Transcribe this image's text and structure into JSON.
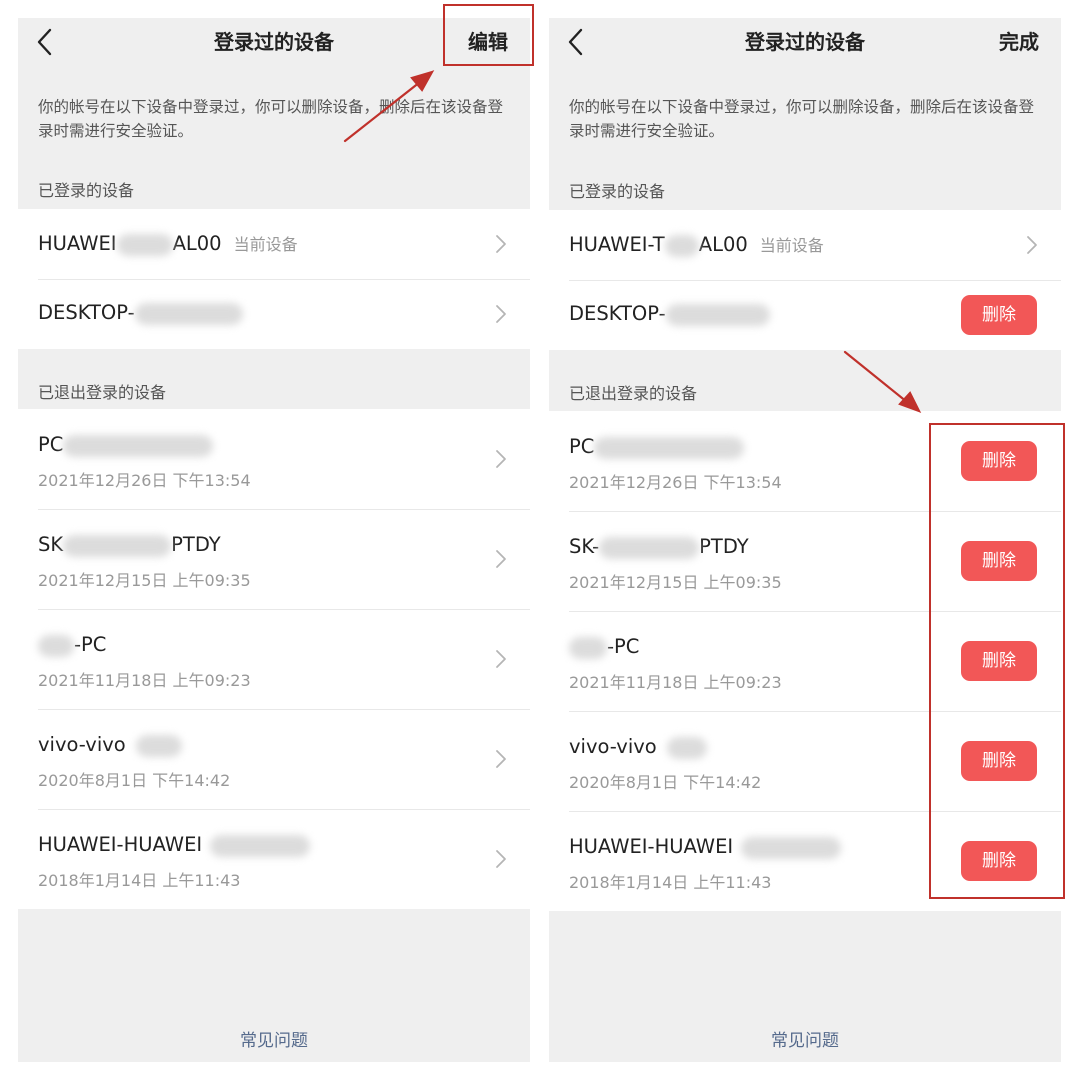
{
  "screens": {
    "left": {
      "back_icon": "chevron-left-icon",
      "title": "登录过的设备",
      "action": "编辑",
      "description": "你的帐号在以下设备中登录过，你可以删除设备，删除后在该设备登录时需进行安全验证。",
      "section_logged_in": "已登录的设备",
      "section_logged_out": "已退出登录的设备",
      "faq": "常见问题"
    },
    "right": {
      "back_icon": "chevron-left-icon",
      "title": "登录过的设备",
      "action": "完成",
      "description": "你的帐号在以下设备中登录过，你可以删除设备，删除后在该设备登录时需进行安全验证。",
      "section_logged_in": "已登录的设备",
      "section_logged_out": "已退出登录的设备",
      "delete_label": "删除",
      "faq": "常见问题"
    }
  },
  "devices_logged_in": {
    "left": [
      {
        "prefix": "HUAWEI",
        "suffix": "AL00",
        "tag": "当前设备"
      },
      {
        "prefix": "DESKTOP-",
        "suffix": ""
      }
    ],
    "right": [
      {
        "prefix": "HUAWEI-T",
        "suffix": "AL00",
        "tag": "当前设备"
      },
      {
        "prefix": "DESKTOP-",
        "suffix": ""
      }
    ]
  },
  "devices_logged_out": {
    "left": [
      {
        "prefix": "PC",
        "suffix": "",
        "time": "2021年12月26日 下午13:54"
      },
      {
        "prefix": "SK",
        "suffix": "PTDY",
        "time": "2021年12月15日 上午09:35"
      },
      {
        "prefix": "",
        "suffix": "-PC",
        "time": "2021年11月18日 上午09:23"
      },
      {
        "prefix": "vivo-vivo",
        "suffix": "",
        "time": "2020年8月1日 下午14:42"
      },
      {
        "prefix": "HUAWEI-HUAWEI",
        "suffix": "",
        "time": "2018年1月14日 上午11:43"
      }
    ],
    "right": [
      {
        "prefix": "PC",
        "suffix": "",
        "time": "2021年12月26日 下午13:54"
      },
      {
        "prefix": "SK-",
        "suffix": "PTDY",
        "time": "2021年12月15日 上午09:35"
      },
      {
        "prefix": "",
        "suffix": "-PC",
        "time": "2021年11月18日 上午09:23"
      },
      {
        "prefix": "vivo-vivo",
        "suffix": "",
        "time": "2020年8月1日 下午14:42"
      },
      {
        "prefix": "HUAWEI-HUAWEI",
        "suffix": "",
        "time": "2018年1月14日 上午11:43"
      }
    ]
  },
  "icons": {
    "row_chevron": "chevron-right-icon"
  },
  "colors": {
    "delete_button": "#f25757",
    "annotation": "#c0312b",
    "faq_link": "#556a8c"
  }
}
